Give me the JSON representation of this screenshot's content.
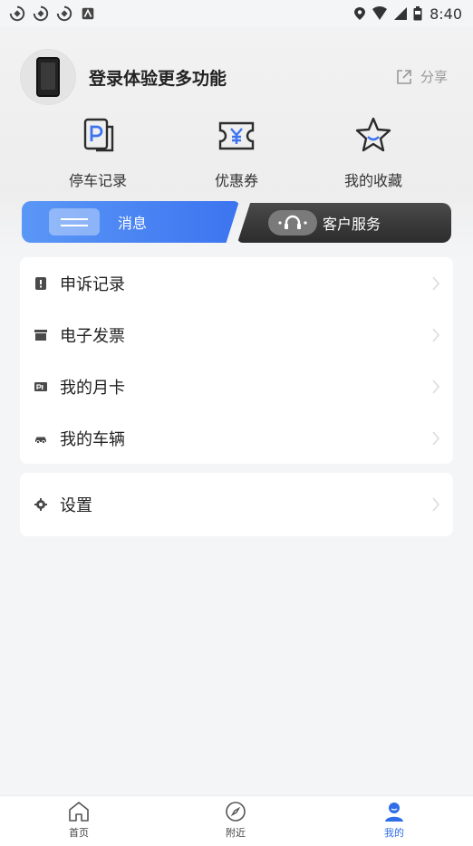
{
  "status_bar": {
    "time": "8:40"
  },
  "header": {
    "login_prompt": "登录体验更多功能",
    "share_label": "分享"
  },
  "quick_actions": [
    {
      "label": "停车记录",
      "icon": "parking-record-icon"
    },
    {
      "label": "优惠券",
      "icon": "coupon-icon"
    },
    {
      "label": "我的收藏",
      "icon": "star-icon"
    }
  ],
  "tabs": {
    "messages": "消息",
    "customer_service": "客户服务"
  },
  "menu": [
    {
      "label": "申诉记录",
      "icon": "appeal-icon"
    },
    {
      "label": "电子发票",
      "icon": "invoice-icon"
    },
    {
      "label": "我的月卡",
      "icon": "monthly-card-icon"
    },
    {
      "label": "我的车辆",
      "icon": "car-icon"
    }
  ],
  "settings": {
    "label": "设置",
    "icon": "gear-icon"
  },
  "bottom_nav": [
    {
      "label": "首页",
      "icon": "home-icon",
      "active": false
    },
    {
      "label": "附近",
      "icon": "compass-icon",
      "active": false
    },
    {
      "label": "我的",
      "icon": "user-icon",
      "active": true
    }
  ],
  "colors": {
    "accent": "#2f6ee8",
    "dark_tab": "#333333"
  }
}
